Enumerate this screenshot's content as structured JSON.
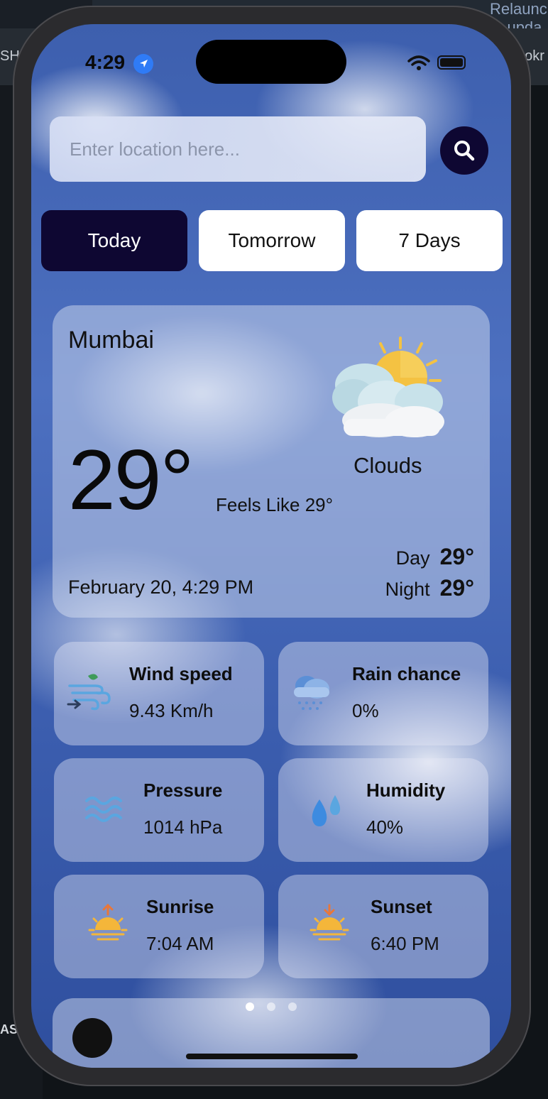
{
  "desktop": {
    "relaunch_text": "Relaunch to upda",
    "left_text": "SHE",
    "right_text": "ookr",
    "bottom_left_text": "AS"
  },
  "status_bar": {
    "time": "4:29"
  },
  "search": {
    "placeholder": "Enter location here..."
  },
  "tabs": [
    {
      "label": "Today",
      "active": true
    },
    {
      "label": "Tomorrow",
      "active": false
    },
    {
      "label": "7 Days",
      "active": false
    }
  ],
  "weather": {
    "city": "Mumbai",
    "temperature": "29°",
    "feels_like": "Feels Like 29°",
    "condition": "Clouds",
    "date_time": "February 20, 4:29 PM",
    "day_label": "Day",
    "day_temp": "29°",
    "night_label": "Night",
    "night_temp": "29°"
  },
  "tiles": [
    {
      "label": "Wind speed",
      "value": "9.43 Km/h",
      "icon": "wind-icon"
    },
    {
      "label": "Rain chance",
      "value": "0%",
      "icon": "rain-cloud-icon"
    },
    {
      "label": "Pressure",
      "value": "1014 hPa",
      "icon": "waves-icon"
    },
    {
      "label": "Humidity",
      "value": "40%",
      "icon": "droplets-icon"
    },
    {
      "label": "Sunrise",
      "value": "7:04 AM",
      "icon": "sunrise-icon"
    },
    {
      "label": "Sunset",
      "value": "6:40 PM",
      "icon": "sunset-icon"
    }
  ],
  "pager": {
    "count": 3,
    "active_index": 0
  },
  "colors": {
    "accent_dark": "#0e0732",
    "sun": "#f4c242",
    "location_arrow": "#2f7bf6"
  }
}
